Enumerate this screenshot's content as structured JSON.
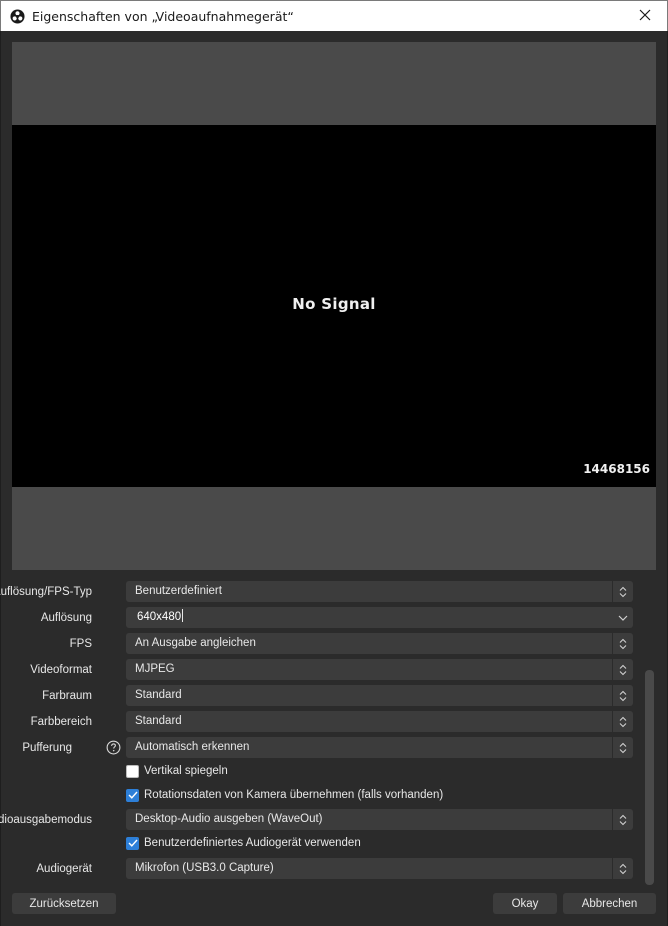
{
  "window": {
    "title": "Eigenschaften von „Videoaufnahmegerät“",
    "app_icon": "obs-logo-icon",
    "close_icon": "close-icon"
  },
  "preview": {
    "message": "No Signal",
    "serial": "14468156"
  },
  "form": {
    "resolution_type": {
      "label": "Auflösung/FPS-Typ",
      "value": "Benutzerdefiniert"
    },
    "resolution": {
      "label": "Auflösung",
      "value": "640x480"
    },
    "fps": {
      "label": "FPS",
      "value": "An Ausgabe angleichen"
    },
    "video_format": {
      "label": "Videoformat",
      "value": "MJPEG"
    },
    "color_space": {
      "label": "Farbraum",
      "value": "Standard"
    },
    "color_range": {
      "label": "Farbbereich",
      "value": "Standard"
    },
    "buffering": {
      "label": "Pufferung",
      "value": "Automatisch erkennen",
      "help_icon": "help-circle-icon"
    },
    "flip_vertical": {
      "label": "Vertikal spiegeln",
      "checked": false
    },
    "apply_rotation": {
      "label": "Rotationsdaten von Kamera übernehmen (falls vorhanden)",
      "checked": true
    },
    "audio_output_mode": {
      "label": "Audioausgabemodus",
      "value": "Desktop-Audio ausgeben (WaveOut)"
    },
    "custom_audio_device": {
      "label": "Benutzerdefiniertes Audiogerät verwenden",
      "checked": true
    },
    "audio_device": {
      "label": "Audiogerät",
      "value": "Mikrofon (USB3.0 Capture)"
    }
  },
  "buttons": {
    "reset": "Zurücksetzen",
    "ok": "Okay",
    "cancel": "Abbrechen"
  },
  "colors": {
    "background": "#2b2b2b",
    "control": "#3c3c3c",
    "preview_frame": "#4a4a4a",
    "checkbox_accent": "#2d7fd8"
  }
}
